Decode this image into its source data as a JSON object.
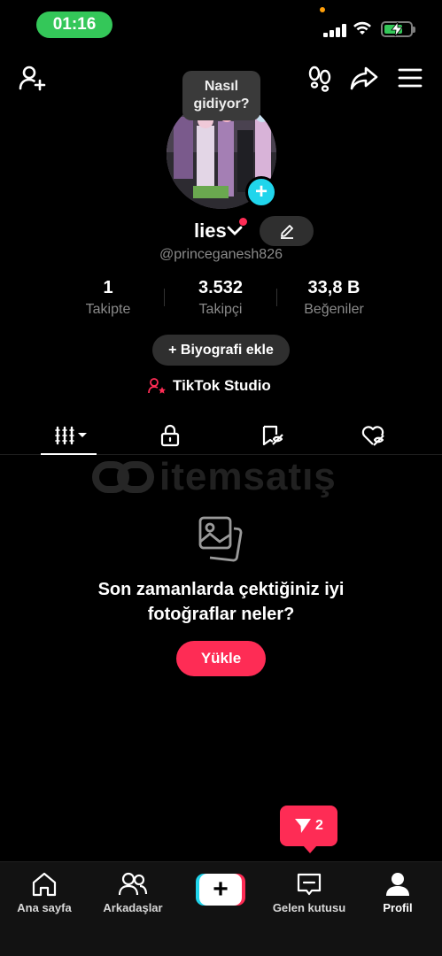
{
  "status_bar": {
    "time": "01:16"
  },
  "profile": {
    "bubble_text_line1": "Nasıl",
    "bubble_text_line2": "gidiyor?",
    "display_name": "lies",
    "handle": "@princeganesh826"
  },
  "stats": [
    {
      "value": "1",
      "label": "Takipte"
    },
    {
      "value": "3.532",
      "label": "Takipçi"
    },
    {
      "value": "33,8 B",
      "label": "Beğeniler"
    }
  ],
  "buttons": {
    "add_bio": "+ Biyografi ekle",
    "studio": "TikTok Studio",
    "upload": "Yükle"
  },
  "tabs": [
    {
      "icon": "videos-grid-icon",
      "active": true
    },
    {
      "icon": "lock-icon",
      "active": false
    },
    {
      "icon": "saved-icon",
      "active": false
    },
    {
      "icon": "liked-icon",
      "active": false
    }
  ],
  "watermark": {
    "text": "itemsatış"
  },
  "empty_state": {
    "line1": "Son zamanlarda çektiğiniz iyi",
    "line2": "fotoğraflar neler?"
  },
  "inbox_badge": {
    "count": "2"
  },
  "bottom_nav": [
    {
      "label": "Ana sayfa",
      "icon": "home-icon"
    },
    {
      "label": "Arkadaşlar",
      "icon": "friends-icon"
    },
    {
      "label": "",
      "icon": "create-icon"
    },
    {
      "label": "Gelen kutusu",
      "icon": "inbox-icon"
    },
    {
      "label": "Profil",
      "icon": "profile-icon",
      "active": true
    }
  ],
  "colors": {
    "accent": "#fe2c55",
    "cyan": "#20d5ec",
    "status_green": "#34c759"
  }
}
